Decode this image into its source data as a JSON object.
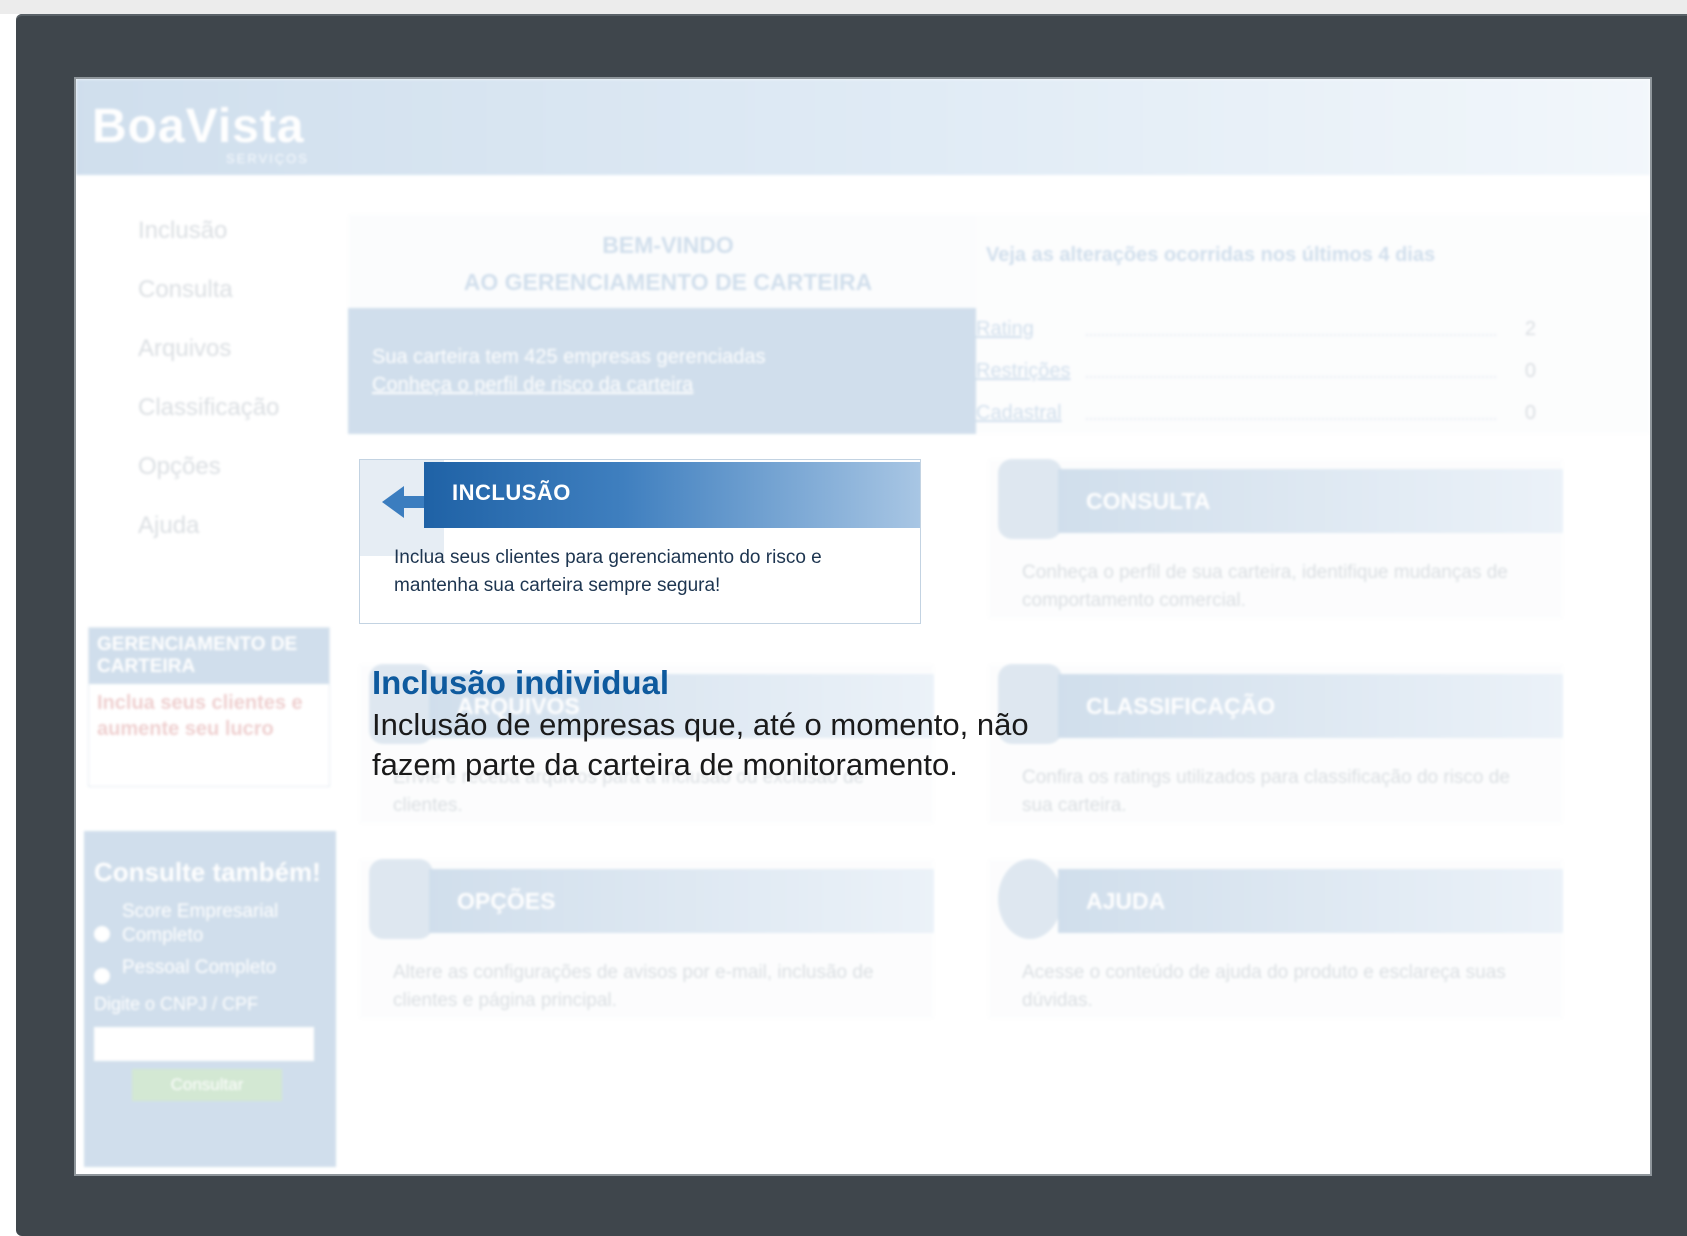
{
  "app": {
    "logo": "BoaVista",
    "logo_subtitle": "SERVIÇOS"
  },
  "nav": {
    "items": [
      "Inclusão",
      "Consulta",
      "Arquivos",
      "Classificação",
      "Opções",
      "Ajuda"
    ]
  },
  "promo": {
    "title": "GERENCIAMENTO DE CARTEIRA",
    "text": "Inclua seus clientes e aumente seu lucro"
  },
  "consult": {
    "title": "Consulte também!",
    "options": [
      "Score Empresarial Completo",
      "Pessoal Completo"
    ],
    "label": "Digite o CNPJ / CPF",
    "input_value": "",
    "button": "Consultar"
  },
  "welcome": {
    "line1": "BEM-VINDO",
    "line2": "AO GERENCIAMENTO DE CARTEIRA",
    "portfolio_text": "Sua carteira tem 425 empresas gerenciadas",
    "portfolio_link": "Conheça o perfil de risco da carteira"
  },
  "changes": {
    "heading": "Veja as alterações ocorridas nos últimos 4 dias",
    "rows": [
      {
        "label": "Rating",
        "value": "2"
      },
      {
        "label": "Restrições",
        "value": "0"
      },
      {
        "label": "Cadastral",
        "value": "0"
      }
    ]
  },
  "cards": {
    "inclusao": {
      "title": "INCLUSÃO",
      "text": "Inclua seus clientes para gerenciamento do risco e mantenha sua carteira sempre segura!"
    },
    "consulta": {
      "title": "CONSULTA",
      "text": "Conheça o perfil de sua carteira, identifique mudanças de comportamento comercial."
    },
    "arquivos": {
      "title": "ARQUIVOS",
      "text": "Envie e receba arquivos para a inclusão ou exclusão de clientes."
    },
    "classificacao": {
      "title": "CLASSIFICAÇÃO",
      "text": "Confira os ratings utilizados para classificação do risco de sua carteira."
    },
    "opcoes": {
      "title": "OPÇÕES",
      "text": "Altere as configurações de avisos por e-mail, inclusão de clientes e página principal."
    },
    "ajuda": {
      "title": "AJUDA",
      "text": "Acesse o conteúdo de ajuda do produto e esclareça suas dúvidas."
    }
  },
  "callout": {
    "title": "Inclusão individual",
    "body": "Inclusão de empresas que, até o momento, não fazem parte da carteira de monitoramento."
  },
  "colors": {
    "accent": "#2f6eab",
    "callout_title": "#0e5a9e",
    "bezel": "#3f464c"
  }
}
